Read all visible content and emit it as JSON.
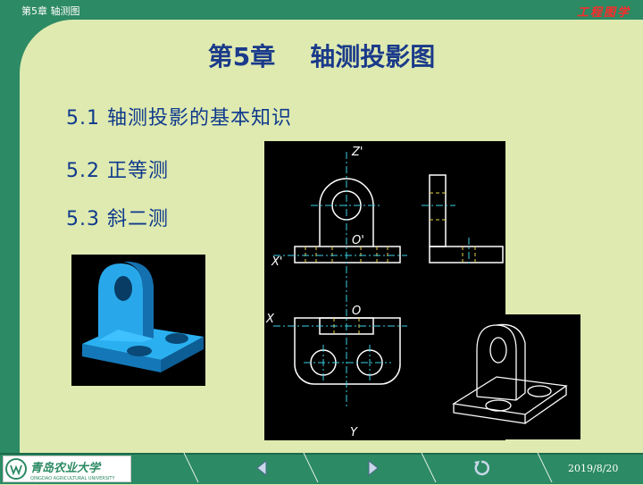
{
  "header": {
    "chapter_label": "第5章 轴测图",
    "course_name": "工程图学"
  },
  "slide": {
    "title": "第5章    轴测投影图",
    "items": [
      {
        "label": "5.1 轴测投影的基本知识"
      },
      {
        "label": "5.2 正等测"
      },
      {
        "label": "5.3 斜二测"
      }
    ]
  },
  "drawing": {
    "labels": {
      "z_axis": "Z'",
      "origin_top": "O'",
      "x_axis_top": "X'",
      "x_axis_bottom": "X",
      "origin_bottom": "O",
      "y_axis": "Y"
    }
  },
  "footer": {
    "logo_text": "青岛农业大学",
    "logo_subtext": "QINGDAO AGRICULTURAL UNIVERSITY",
    "date": "2019/8/20"
  },
  "colors": {
    "theme_green": "#2c8a64",
    "slide_background": "#dfeab0",
    "title_blue": "#1a3a8a",
    "course_red": "#ff2a2a",
    "model_blue": "#1e9fe0"
  },
  "icons": [
    "previous-slide-icon",
    "next-slide-icon",
    "return-icon",
    "university-logo"
  ]
}
